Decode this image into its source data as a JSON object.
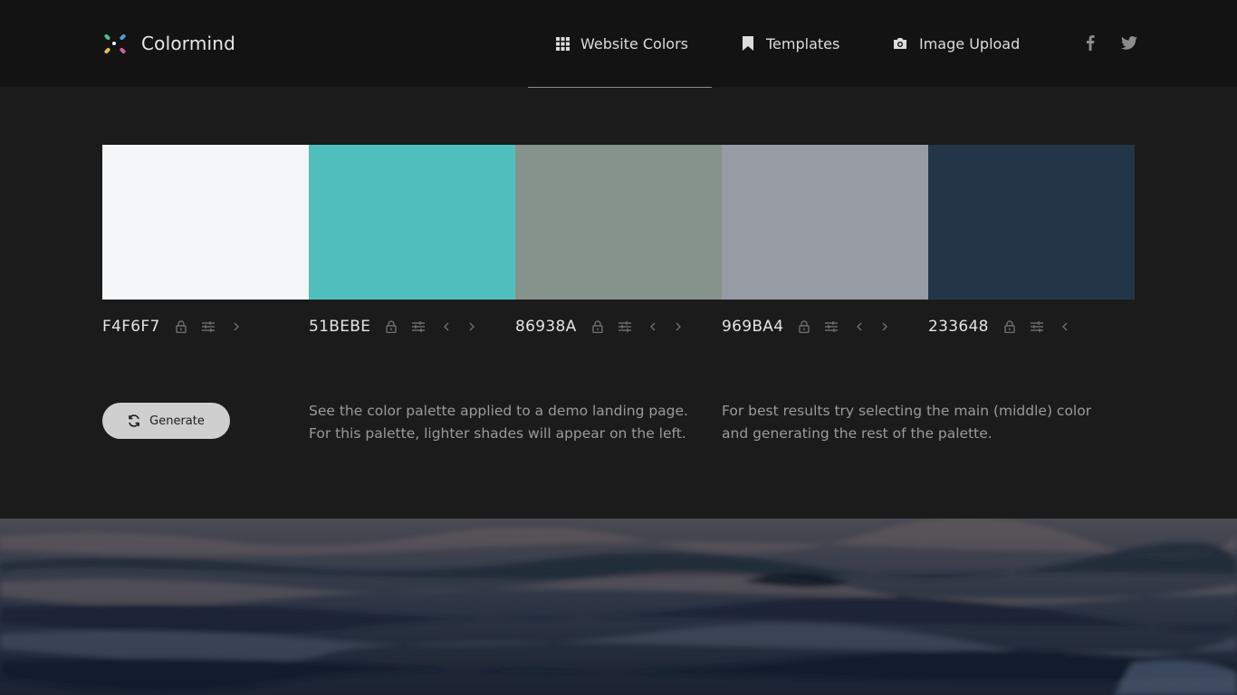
{
  "header": {
    "brand": "Colormind",
    "nav": [
      {
        "label": "Website Colors",
        "icon": "grid-icon",
        "active": true
      },
      {
        "label": "Templates",
        "icon": "bookmark-icon",
        "active": false
      },
      {
        "label": "Image Upload",
        "icon": "camera-icon",
        "active": false
      }
    ],
    "social": [
      "facebook-icon",
      "twitter-icon"
    ]
  },
  "palette": [
    {
      "hex": "F4F6F7",
      "color": "#F4F6F7",
      "controls": [
        "lock-icon",
        "adjust-icon",
        "chevron-right-icon"
      ]
    },
    {
      "hex": "51BEBE",
      "color": "#51BEBE",
      "controls": [
        "lock-icon",
        "adjust-icon",
        "chevron-left-icon",
        "chevron-right-icon"
      ]
    },
    {
      "hex": "86938A",
      "color": "#86938A",
      "controls": [
        "lock-icon",
        "adjust-icon",
        "chevron-left-icon",
        "chevron-right-icon"
      ]
    },
    {
      "hex": "969BA4",
      "color": "#969BA4",
      "controls": [
        "lock-icon",
        "adjust-icon",
        "chevron-left-icon",
        "chevron-right-icon"
      ]
    },
    {
      "hex": "233648",
      "color": "#233648",
      "controls": [
        "lock-icon",
        "adjust-icon",
        "chevron-left-icon"
      ]
    }
  ],
  "actions": {
    "generate_label": "Generate",
    "generate_icon": "refresh-icon"
  },
  "info": {
    "demo_line1": "See the color palette applied to a demo landing page.",
    "demo_line2": "For this palette, lighter shades will appear on the left.",
    "tip_line1": "For best results try selecting the main (middle) color",
    "tip_line2": "and generating the rest of the palette."
  },
  "colors": {
    "header_bg": "#131313",
    "page_bg": "#1B1B1B",
    "button_bg": "#CFCFCF"
  }
}
